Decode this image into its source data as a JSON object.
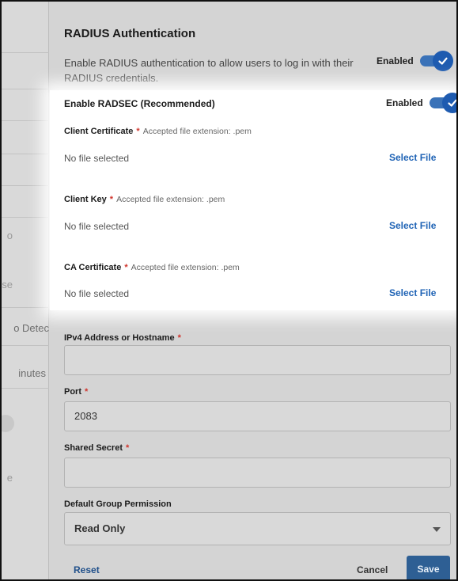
{
  "background": {
    "fragments": [
      "o",
      "se",
      "o Detec",
      "inutes",
      "e"
    ]
  },
  "radius": {
    "title": "RADIUS Authentication",
    "description": "Enable RADIUS authentication to allow users to log in with their RADIUS credentials.",
    "toggle_label": "Enabled",
    "toggle_on": true
  },
  "radsec": {
    "title": "Enable RADSEC (Recommended)",
    "toggle_label": "Enabled",
    "toggle_on": true,
    "required_mark": "*",
    "files": [
      {
        "label": "Client Certificate",
        "hint": "Accepted file extension: .pem",
        "status": "No file selected",
        "action": "Select File"
      },
      {
        "label": "Client Key",
        "hint": "Accepted file extension: .pem",
        "status": "No file selected",
        "action": "Select File"
      },
      {
        "label": "CA Certificate",
        "hint": "Accepted file extension: .pem",
        "status": "No file selected",
        "action": "Select File"
      }
    ]
  },
  "form": {
    "ipv4_label": "IPv4 Address or Hostname",
    "ipv4_value": "",
    "port_label": "Port",
    "port_value": "2083",
    "secret_label": "Shared Secret",
    "secret_value": "",
    "group_label": "Default Group Permission",
    "group_value": "Read Only"
  },
  "actions": {
    "reset": "Reset",
    "cancel": "Cancel",
    "save": "Save"
  },
  "colors": {
    "accent": "#1f63b5",
    "required": "#d0342c",
    "save_button": "#2e5f94"
  }
}
